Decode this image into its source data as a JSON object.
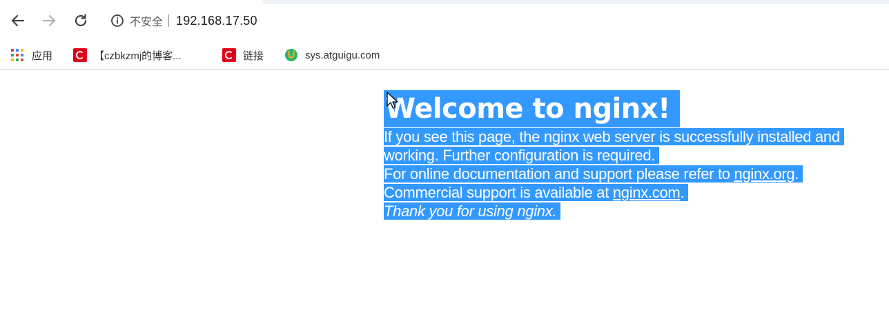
{
  "browser": {
    "insecure_label": "不安全",
    "url": "192.168.17.50"
  },
  "bookmarks": {
    "items": [
      {
        "label": "应用",
        "icon": "apps-grid-icon"
      },
      {
        "label": "【czbkzmj的博客...",
        "icon": "csdn-icon"
      },
      {
        "label": "链接",
        "icon": "csdn-icon"
      },
      {
        "label": "sys.atguigu.com",
        "icon": "atguigu-icon"
      }
    ]
  },
  "page": {
    "heading": "Welcome to nginx!",
    "p1_line1": "If you see this page, the nginx web server is successfully installed and",
    "p1_line2": "working. Further configuration is required.",
    "p2_line1_prefix": "For online documentation and support please refer to ",
    "p2_link1": "nginx.org",
    "p2_line1_suffix": ".",
    "p2_line2_prefix": "Commercial support is available at ",
    "p2_link2": "nginx.com",
    "p2_line2_suffix": ".",
    "thanks": "Thank you for using nginx."
  },
  "colors": {
    "selection": "#3399ff",
    "csdn_red": "#e3001b"
  }
}
